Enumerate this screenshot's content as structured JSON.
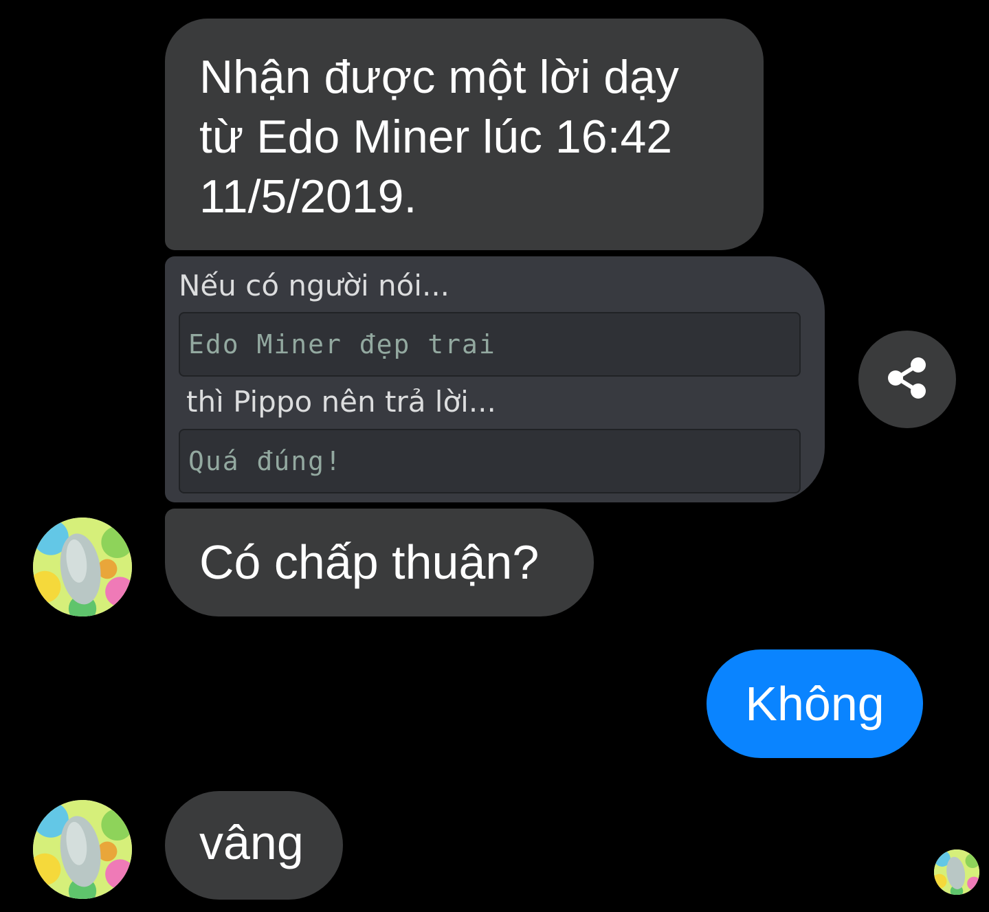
{
  "messages": {
    "lesson": "Nhận được một lời dạy từ Edo Miner lúc 16:42 11/5/2019.",
    "card": {
      "if_label": "Nếu có người nói...",
      "if_value": "Edo Miner đẹp trai",
      "then_label": "thì Pippo nên trả lời...",
      "then_value": "Quá đúng!"
    },
    "question": "Có chấp thuận?",
    "reply_out": "Không",
    "reply_in": "vâng"
  },
  "icons": {
    "share": "share-icon",
    "avatar": "avatar-seed-image"
  },
  "colors": {
    "background": "#000000",
    "incoming_bubble": "#3a3b3c",
    "outgoing_bubble": "#0a84ff",
    "card_background": "#383a40",
    "code_background": "#2f3136"
  }
}
